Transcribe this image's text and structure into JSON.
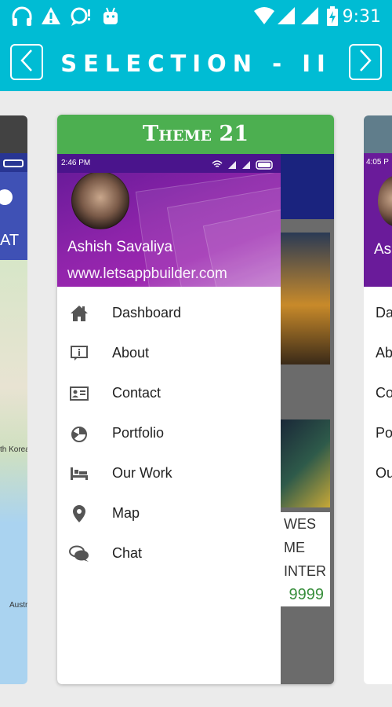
{
  "status_bar": {
    "time": "9:31",
    "left_icons": [
      "headphones-icon",
      "warning-icon",
      "chat-alert-icon",
      "android-icon"
    ],
    "right_icons": [
      "wifi-icon",
      "signal-icon",
      "signal-icon",
      "battery-charging-icon"
    ]
  },
  "app_bar": {
    "title": "SELECTION - II",
    "prev_icon": "chevron-left-icon",
    "next_icon": "chevron-right-icon"
  },
  "card": {
    "title": "Theme 21",
    "header_color": "#4caf50",
    "inner_status_time": "2:46 PM",
    "drawer": {
      "user_name": "Ashish Savaliya",
      "user_url": "www.letsappbuilder.com",
      "items": [
        {
          "label": "Dashboard",
          "icon": "home-icon"
        },
        {
          "label": "About",
          "icon": "info-icon"
        },
        {
          "label": "Contact",
          "icon": "contact-card-icon"
        },
        {
          "label": "Portfolio",
          "icon": "pie-chart-icon"
        },
        {
          "label": "Our Work",
          "icon": "bed-icon"
        },
        {
          "label": "Map",
          "icon": "map-pin-icon"
        },
        {
          "label": "Chat",
          "icon": "chat-icon"
        }
      ]
    },
    "background_content": {
      "lines": [
        "WES",
        "ME",
        "INTER"
      ],
      "price": "9999"
    }
  },
  "left_card": {
    "label": "AT",
    "map_label_1": "th Korea",
    "map_label_2": "Austr"
  },
  "right_card": {
    "inner_status_time": "4:05 P",
    "hero_text": "Ash",
    "items": [
      "Da",
      "Ab",
      "Co",
      "Po",
      "Ou"
    ]
  },
  "colors": {
    "accent": "#00bcd4",
    "theme_green": "#4caf50",
    "drawer_purple": "#8e24aa"
  }
}
